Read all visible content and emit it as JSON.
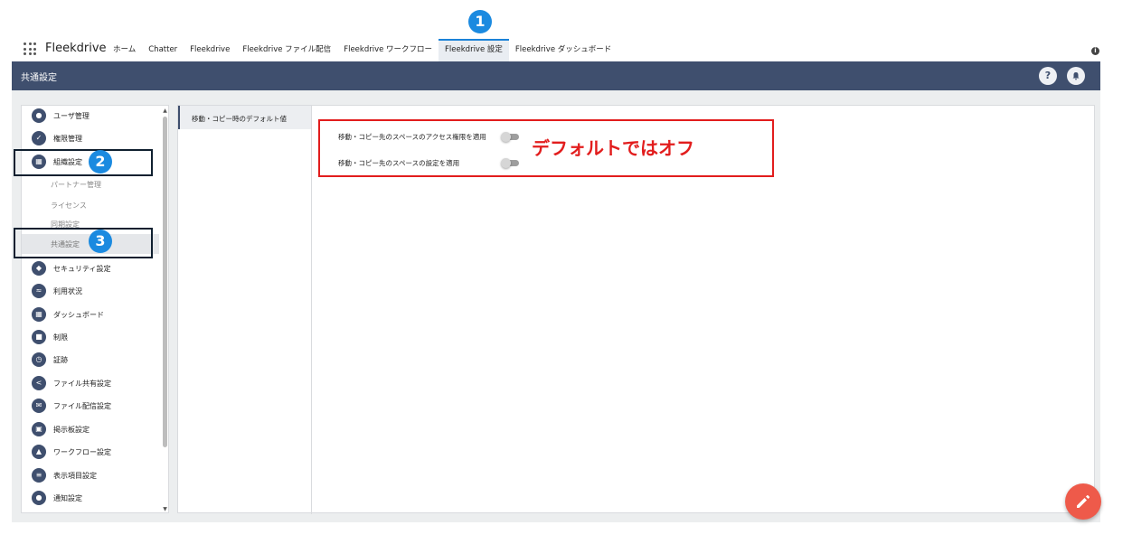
{
  "app": {
    "name": "Fleekdrive"
  },
  "tabs": [
    "ホーム",
    "Chatter",
    "Fleekdrive",
    "Fleekdrive ファイル配信",
    "Fleekdrive ワークフロー",
    "Fleekdrive 設定",
    "Fleekdrive ダッシュボード"
  ],
  "active_tab": "Fleekdrive 設定",
  "header": {
    "title": "共通設定",
    "help_glyph": "?"
  },
  "sidebar": {
    "items": [
      {
        "label": "ユーザ管理",
        "icon": "user-icon"
      },
      {
        "label": "権限管理",
        "icon": "shield-check-icon"
      },
      {
        "label": "組織設定",
        "icon": "building-icon"
      },
      {
        "label": "パートナー管理",
        "sub": true
      },
      {
        "label": "ライセンス",
        "sub": true
      },
      {
        "label": "同期設定",
        "sub": true
      },
      {
        "label": "共通設定",
        "sub": true,
        "selected": true
      },
      {
        "label": "セキュリティ設定",
        "icon": "security-shield-icon"
      },
      {
        "label": "利用状況",
        "icon": "chart-icon"
      },
      {
        "label": "ダッシュボード",
        "icon": "dashboard-icon"
      },
      {
        "label": "制限",
        "icon": "camera-icon"
      },
      {
        "label": "証跡",
        "icon": "clock-icon"
      },
      {
        "label": "ファイル共有設定",
        "icon": "share-icon"
      },
      {
        "label": "ファイル配信設定",
        "icon": "mail-icon"
      },
      {
        "label": "掲示板設定",
        "icon": "calendar-icon"
      },
      {
        "label": "ワークフロー設定",
        "icon": "person-upload-icon"
      },
      {
        "label": "表示項目設定",
        "icon": "list-icon"
      },
      {
        "label": "通知設定",
        "icon": "bell-icon"
      }
    ]
  },
  "panel": {
    "nav_item": "移動・コピー時のデフォルト値",
    "settings": [
      {
        "label": "移動・コピー先のスペースのアクセス権限を適用",
        "enabled": false
      },
      {
        "label": "移動・コピー先のスペースの設定を適用",
        "enabled": false
      }
    ]
  },
  "annotations": {
    "note": "デフォルトではオフ",
    "badges": [
      "1",
      "2",
      "3"
    ]
  },
  "colors": {
    "header": "#3f4f6e",
    "accent": "#1b82d8",
    "annotation_red": "#e21d1d",
    "fab": "#ee5a4a"
  }
}
